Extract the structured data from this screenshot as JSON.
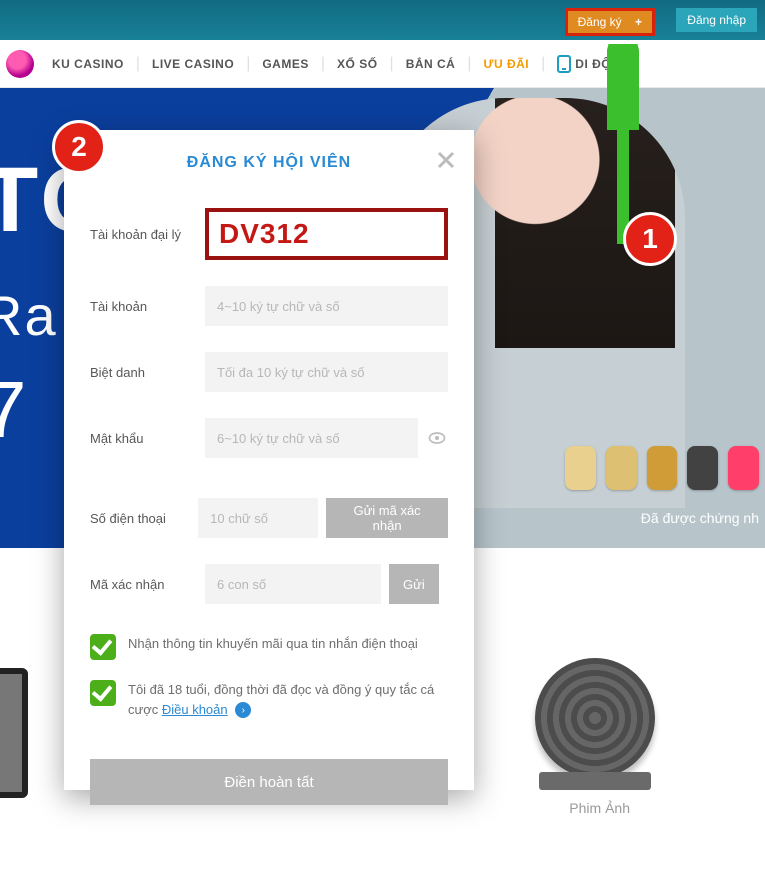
{
  "topbar": {
    "register": "Đăng ký",
    "login": "Đăng nhập"
  },
  "nav": {
    "items": [
      "KU CASINO",
      "LIVE CASINO",
      "GAMES",
      "XỔ SỐ",
      "BẮN CÁ",
      "ƯU ĐÃI",
      "DI ĐỘNG"
    ]
  },
  "hero": {
    "row1": "TC",
    "row2": "Ra",
    "row3": "7",
    "verified": "Đã được chứng nh"
  },
  "media": {
    "reel_label": "Phim Ảnh"
  },
  "modal": {
    "title": "ĐĂNG KÝ HỘI VIÊN",
    "labels": {
      "agent": "Tài khoản đại lý",
      "account": "Tài khoản",
      "nickname": "Biệt danh",
      "password": "Mật khẩu",
      "phone": "Số điện thoại",
      "code": "Mã xác nhận"
    },
    "agent_value": "DV312",
    "placeholders": {
      "account": "4~10 ký tự chữ và số",
      "nickname": "Tối đa 10 ký tự chữ và số",
      "password": "6~10 ký tự chữ và số",
      "phone": "10 chữ số",
      "code": "6 con số"
    },
    "buttons": {
      "send_code": "Gửi mã xác nhận",
      "send": "Gửi",
      "submit": "Điền hoàn tất"
    },
    "check1": "Nhận thông tin khuyến mãi qua tin nhắn điện thoại",
    "check2_pre": "Tôi đã 18 tuổi, đồng thời đã đọc và đồng ý quy tắc cá cược ",
    "check2_terms": "Điều khoản"
  },
  "annotations": {
    "b1": "1",
    "b2": "2"
  }
}
